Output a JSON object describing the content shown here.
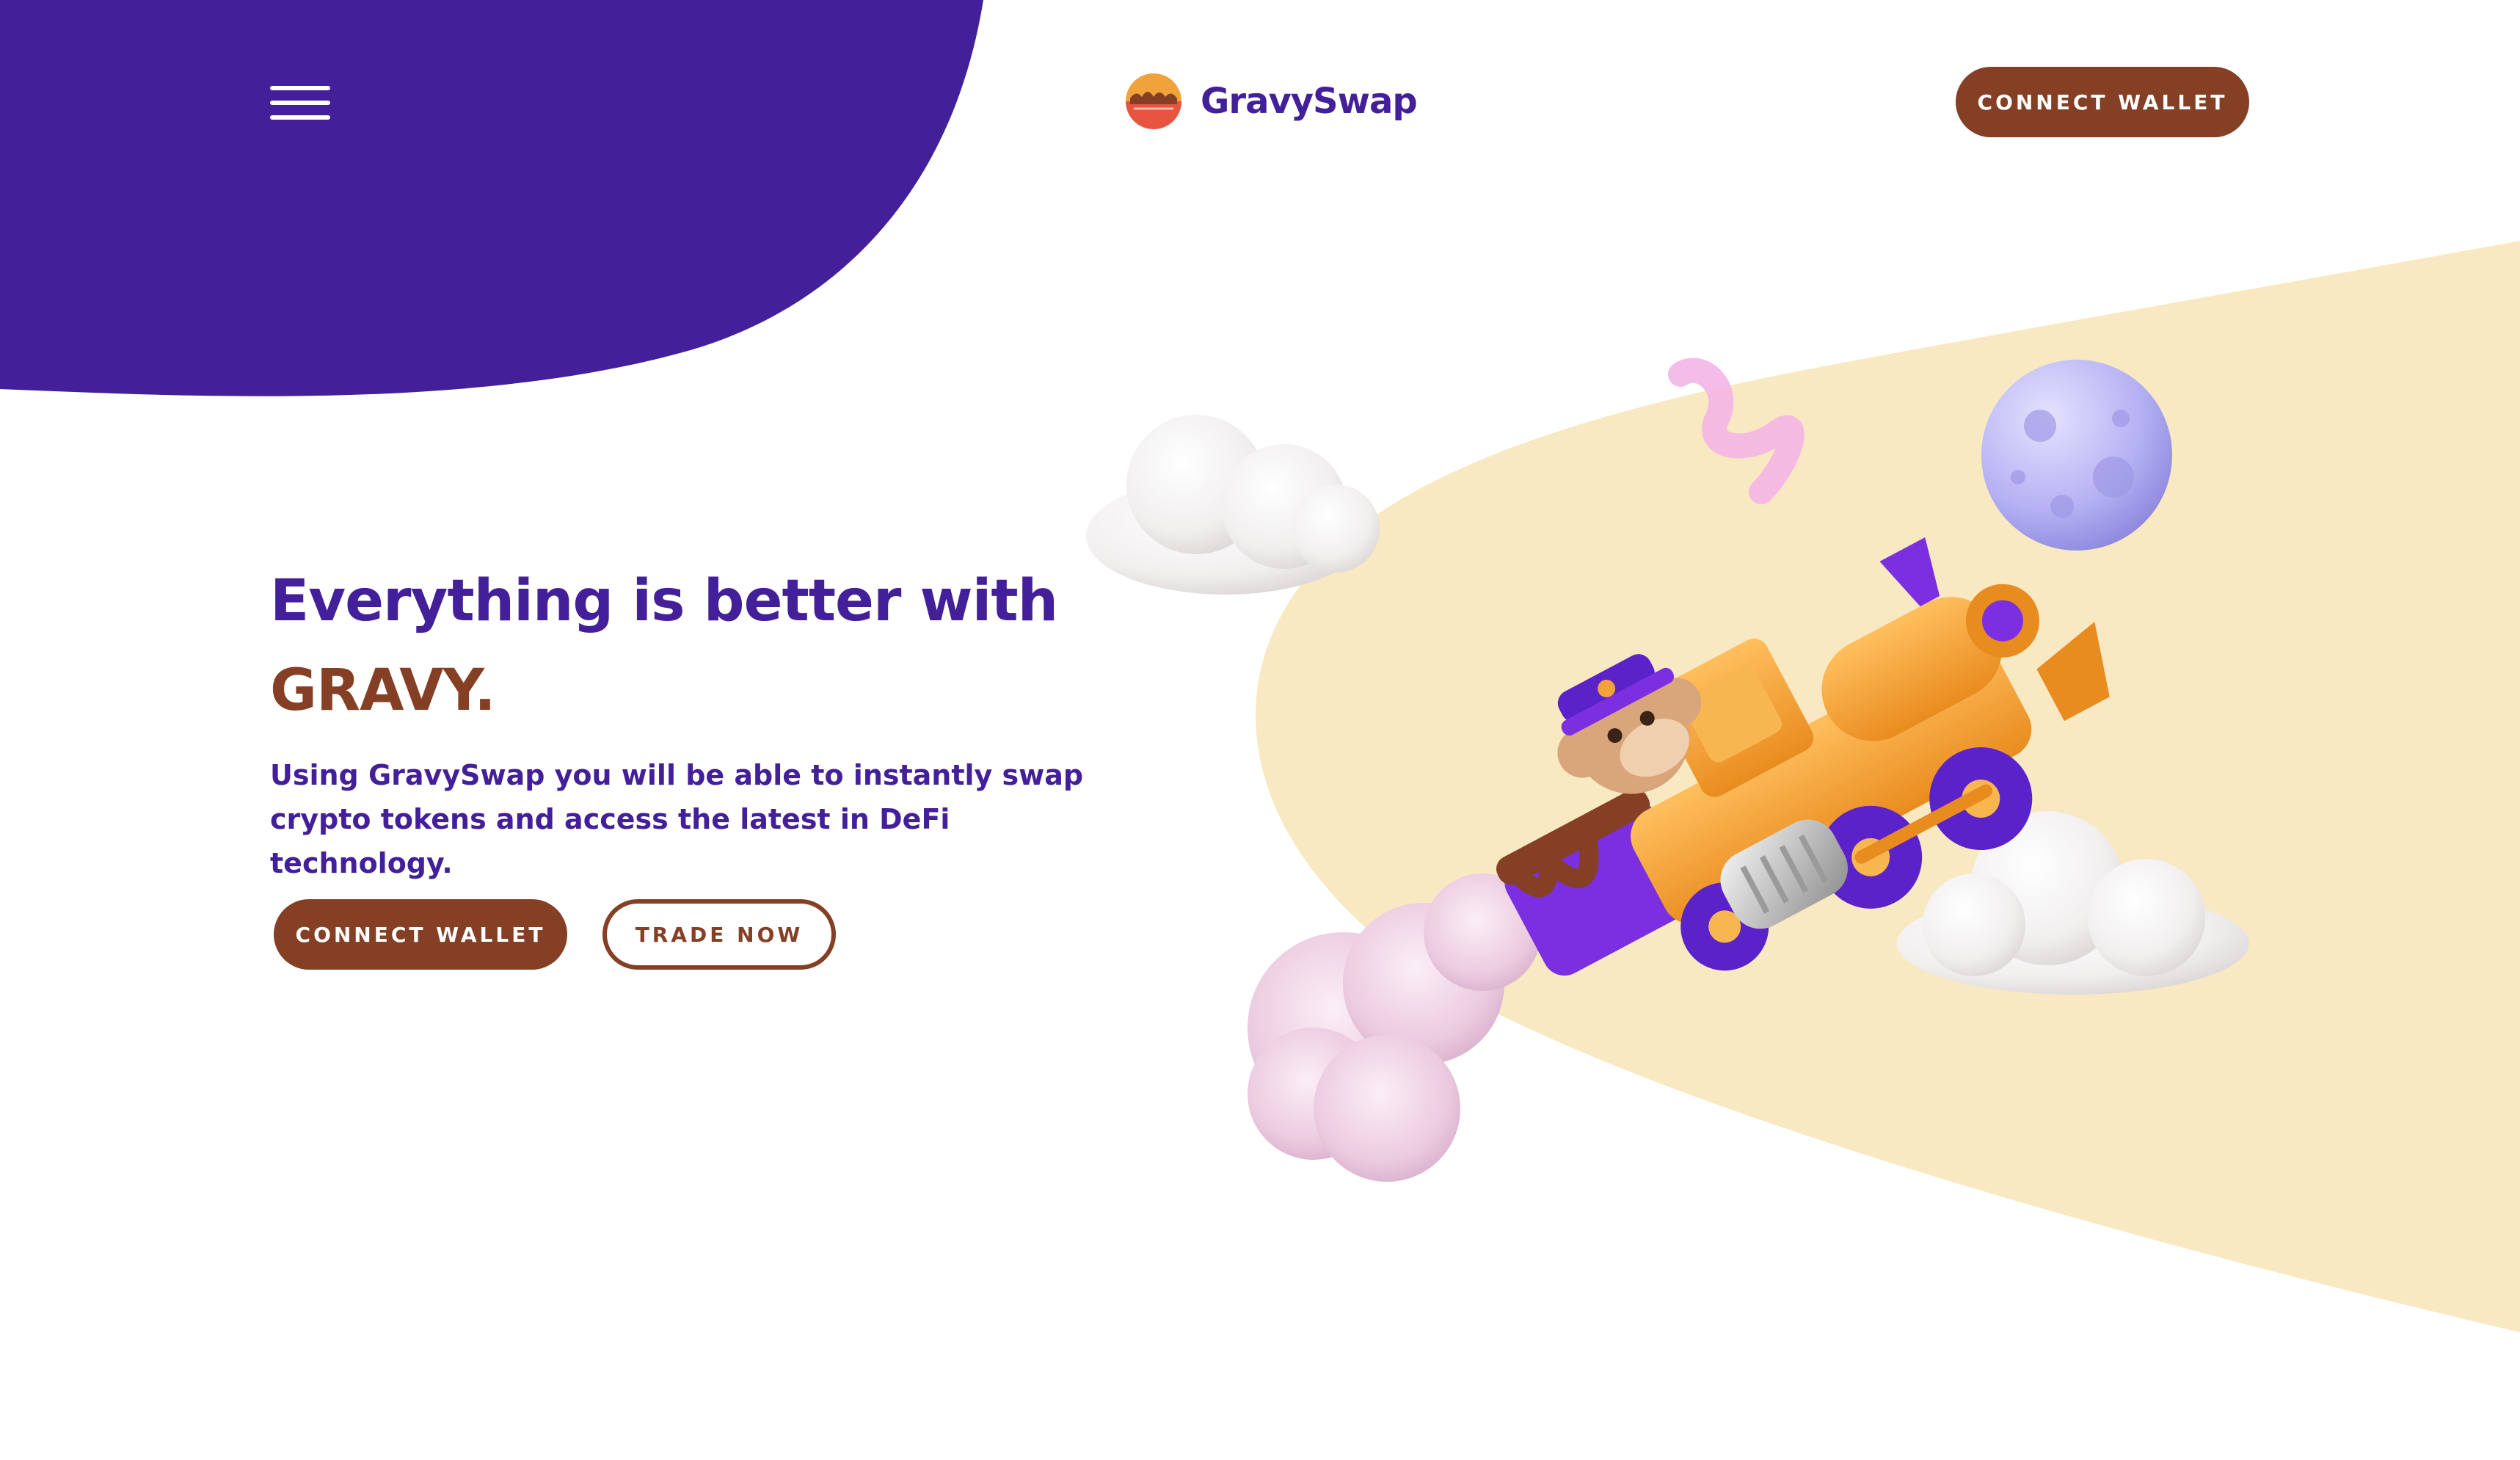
{
  "header": {
    "brand_name": "GravySwap",
    "connect_wallet_label": "CONNECT WALLET"
  },
  "hero": {
    "title_line1": "Everything is better with",
    "title_accent": "GRAVY.",
    "description": "Using GravySwap you will be able to instantly swap crypto tokens and access the latest in DeFi technology.",
    "connect_wallet_label": "CONNECT WALLET",
    "trade_now_label": "TRADE NOW"
  },
  "icons": {
    "menu": "hamburger-menu-icon",
    "logo": "gravy-bowl-logo-icon"
  },
  "colors": {
    "brand_purple": "#43209a",
    "brand_brown": "#843f24",
    "cream": "#f9e9c2",
    "background": "#ffffff"
  }
}
